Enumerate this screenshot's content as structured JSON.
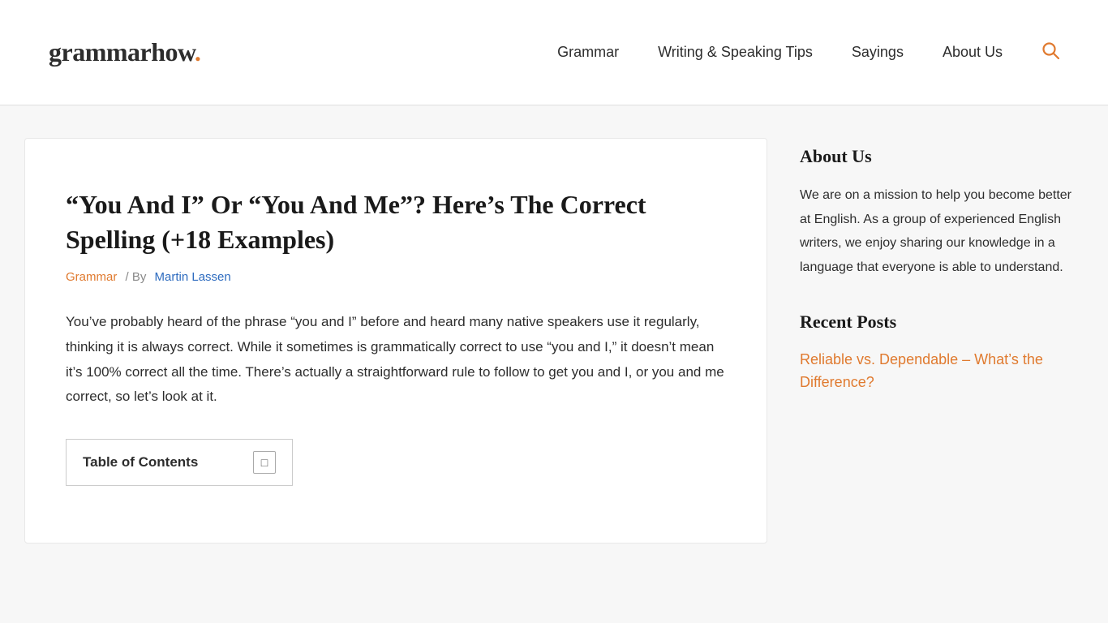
{
  "header": {
    "logo_text": "grammarhow",
    "logo_dot": ".",
    "nav": {
      "items": [
        {
          "label": "Grammar",
          "href": "#"
        },
        {
          "label": "Writing & Speaking Tips",
          "href": "#"
        },
        {
          "label": "Sayings",
          "href": "#"
        },
        {
          "label": "About Us",
          "href": "#"
        }
      ]
    }
  },
  "article": {
    "title": "“You And I” Or “You And Me”? Here’s The Correct Spelling (+18 Examples)",
    "category": "Grammar",
    "meta_separator": "/ By",
    "author": "Martin Lassen",
    "intro": "You’ve probably heard of the phrase “you and I” before and heard many native speakers use it regularly, thinking it is always correct. While it sometimes is grammatically correct to use “you and I,” it doesn’t mean it’s 100% correct all the time. There’s actually a straightforward rule to follow to get you and I, or you and me correct, so let’s look at it.",
    "toc_title": "Table of Contents",
    "toc_toggle_symbol": "□"
  },
  "sidebar": {
    "about_heading": "About Us",
    "about_text": "We are on a mission to help you become better at English. As a group of experienced English writers, we enjoy sharing our knowledge in a language that everyone is able to understand.",
    "recent_posts_heading": "Recent Posts",
    "recent_post_link": "Reliable vs. Dependable – What’s the Difference?"
  }
}
